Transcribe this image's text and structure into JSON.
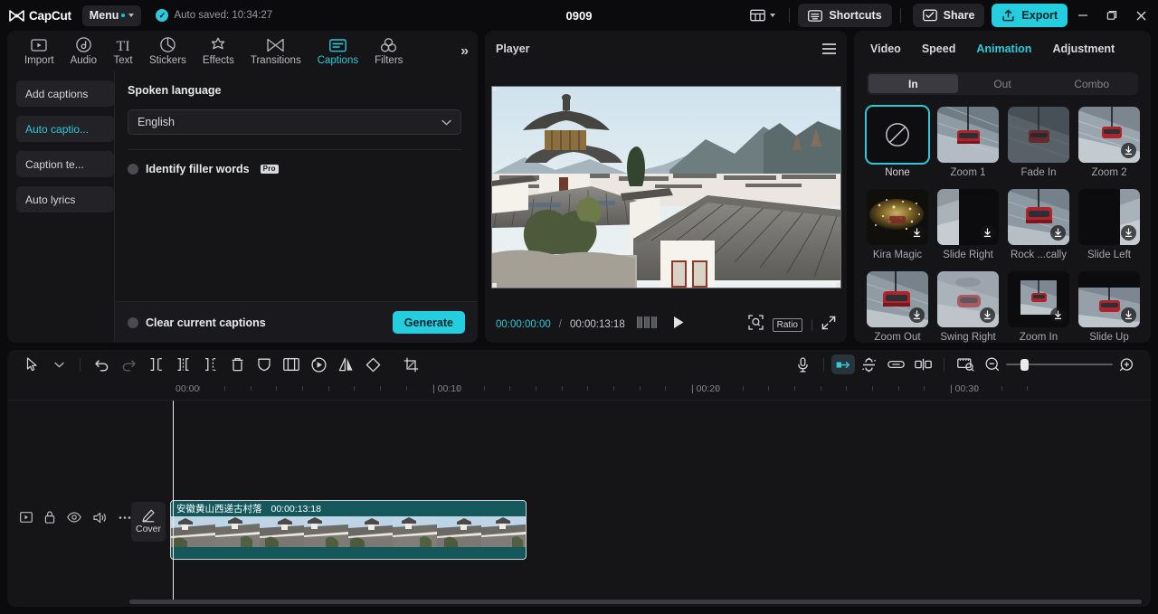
{
  "titlebar": {
    "brand": "CapCut",
    "menu_label": "Menu",
    "autosave": "Auto saved: 10:34:27",
    "project_title": "0909",
    "shortcuts_label": "Shortcuts",
    "share_label": "Share",
    "export_label": "Export",
    "accent": "#25cede"
  },
  "left_panel": {
    "tabs": [
      {
        "label": "Import",
        "icon": "import-icon"
      },
      {
        "label": "Audio",
        "icon": "audio-icon"
      },
      {
        "label": "Text",
        "icon": "text-icon"
      },
      {
        "label": "Stickers",
        "icon": "stickers-icon"
      },
      {
        "label": "Effects",
        "icon": "effects-icon"
      },
      {
        "label": "Transitions",
        "icon": "transitions-icon"
      },
      {
        "label": "Captions",
        "icon": "captions-icon"
      },
      {
        "label": "Filters",
        "icon": "filters-icon"
      }
    ],
    "active_tab": "Captions",
    "more_label": "»",
    "side_buttons": [
      {
        "label": "Add captions",
        "active": false
      },
      {
        "label": "Auto captio...",
        "active": true
      },
      {
        "label": "Caption te...",
        "active": false
      },
      {
        "label": "Auto lyrics",
        "active": false
      }
    ],
    "spoken_language_label": "Spoken language",
    "language_value": "English",
    "filler_words_label": "Identify filler words",
    "pro_badge": "Pro",
    "clear_captions_label": "Clear current captions",
    "generate_label": "Generate"
  },
  "player": {
    "title": "Player",
    "current_time": "00:00:00:00",
    "time_separator": "/",
    "total_time": "00:00:13:18",
    "ratio_label": "Ratio"
  },
  "right_panel": {
    "tabs": [
      {
        "label": "Video",
        "active": false
      },
      {
        "label": "Speed",
        "active": false
      },
      {
        "label": "Animation",
        "active": true
      },
      {
        "label": "Adjustment",
        "active": false
      }
    ],
    "segments": [
      {
        "label": "In",
        "active": true
      },
      {
        "label": "Out",
        "active": false
      },
      {
        "label": "Combo",
        "active": false
      }
    ],
    "animations": [
      {
        "label": "None",
        "kind": "none",
        "selected": true,
        "download": false
      },
      {
        "label": "Zoom 1",
        "kind": "cable-car",
        "selected": false,
        "download": false
      },
      {
        "label": "Fade In",
        "kind": "cable-car-fade",
        "selected": false,
        "download": false
      },
      {
        "label": "Zoom 2",
        "kind": "cable-car",
        "selected": false,
        "download": true
      },
      {
        "label": "Kira Magic",
        "kind": "sparkle",
        "selected": false,
        "download": true
      },
      {
        "label": "Slide Right",
        "kind": "slide-right",
        "selected": false,
        "download": true
      },
      {
        "label": "Rock ...cally",
        "kind": "cable-car",
        "selected": false,
        "download": true
      },
      {
        "label": "Slide Left",
        "kind": "slide-left",
        "selected": false,
        "download": true
      },
      {
        "label": "Zoom Out",
        "kind": "cable-car",
        "selected": false,
        "download": true
      },
      {
        "label": "Swing Right",
        "kind": "cable-car-blur",
        "selected": false,
        "download": true
      },
      {
        "label": "Zoom In",
        "kind": "zoom-in",
        "selected": false,
        "download": true
      },
      {
        "label": "Slide Up",
        "kind": "slide-up",
        "selected": false,
        "download": true
      }
    ]
  },
  "timeline": {
    "tools": [
      {
        "name": "select-tool",
        "disabled": false
      },
      {
        "name": "select-dropdown",
        "disabled": false
      },
      {
        "name": "undo-tool",
        "disabled": false
      },
      {
        "name": "redo-tool",
        "disabled": true
      },
      {
        "name": "split-tool",
        "disabled": false
      },
      {
        "name": "trim-left-tool",
        "disabled": false
      },
      {
        "name": "trim-right-tool",
        "disabled": false
      },
      {
        "name": "delete-tool",
        "disabled": false
      },
      {
        "name": "mask-tool",
        "disabled": false
      },
      {
        "name": "crop-frame-tool",
        "disabled": false
      },
      {
        "name": "freeze-tool",
        "disabled": false
      },
      {
        "name": "mirror-tool",
        "disabled": false
      },
      {
        "name": "rotate-tool",
        "disabled": false
      },
      {
        "name": "crop-tool",
        "disabled": false
      }
    ],
    "right_tools": [
      {
        "name": "mic-record-tool"
      },
      {
        "name": "keyframe-tool",
        "active": true
      },
      {
        "name": "magnet-snap-tool"
      },
      {
        "name": "link-tool"
      },
      {
        "name": "auto-cut-tool"
      },
      {
        "name": "fit-timeline-tool"
      },
      {
        "name": "zoom-out-tool"
      },
      {
        "name": "zoom-in-tool"
      }
    ],
    "ruler_labels": [
      "00:00",
      "00:10",
      "00:20",
      "00:30"
    ],
    "cover_label": "Cover",
    "clip": {
      "name": "安徽黄山西递古村落",
      "duration": "00:00:13:18"
    },
    "track_controls": [
      "track-thumbnail-toggle-icon",
      "lock-icon",
      "eye-icon",
      "volume-icon",
      "more-icon"
    ]
  }
}
